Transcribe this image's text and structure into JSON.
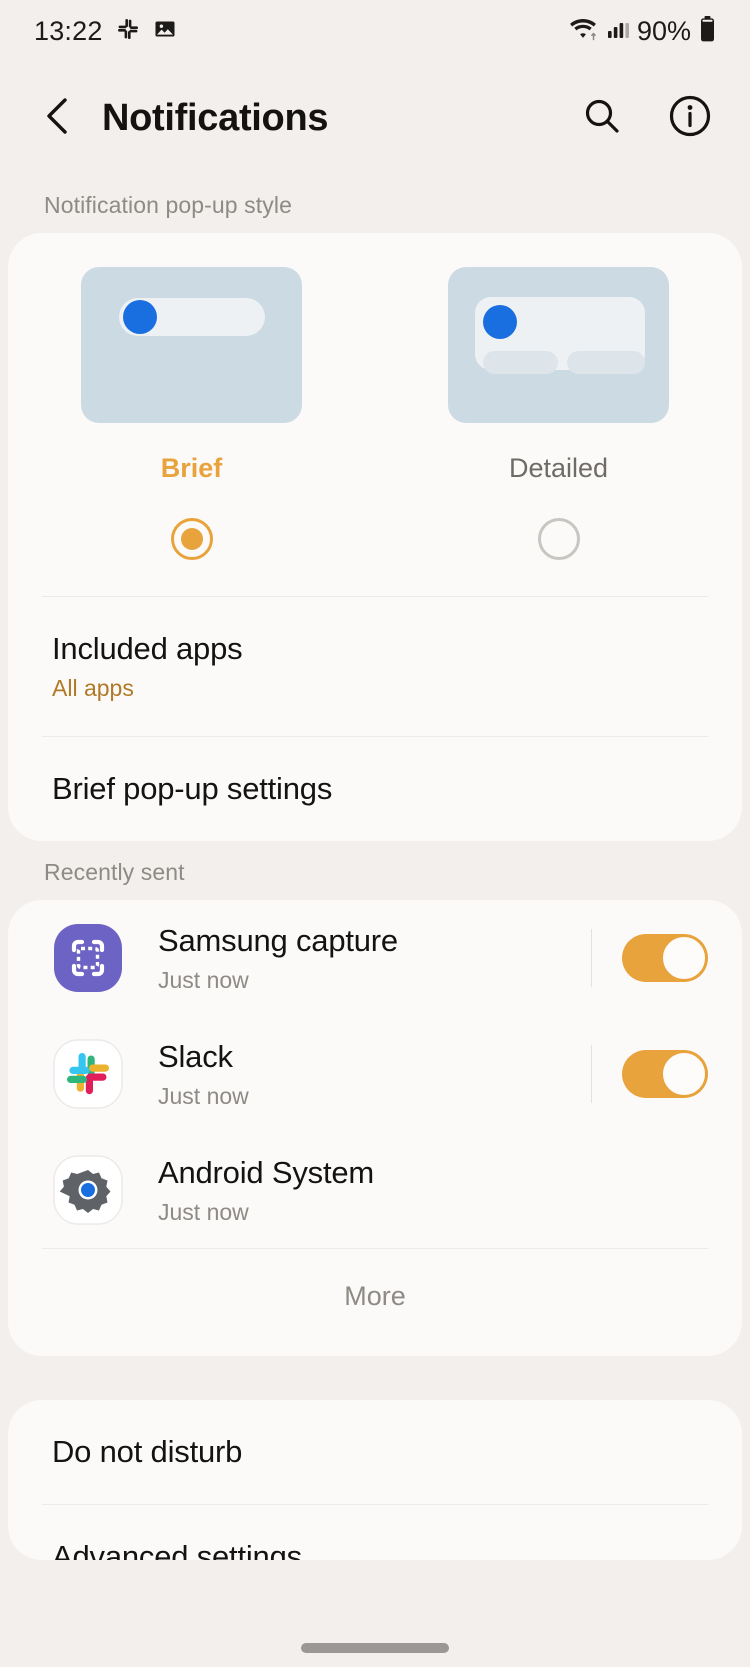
{
  "status_bar": {
    "time": "13:22",
    "battery_percent": "90%",
    "icons": [
      "slack-icon",
      "image-icon",
      "wifi-icon",
      "signal-icon",
      "battery-icon"
    ]
  },
  "header": {
    "title": "Notifications",
    "back_icon": "back-chevron-icon",
    "search_icon": "search-icon",
    "info_icon": "info-icon"
  },
  "popup_style": {
    "section_label": "Notification pop-up style",
    "options": [
      {
        "label": "Brief",
        "selected": true
      },
      {
        "label": "Detailed",
        "selected": false
      }
    ],
    "accent_color": "#e8a33c",
    "preview_bg": "#ccdae4",
    "preview_dot_color": "#1a6fe0"
  },
  "style_links": [
    {
      "title": "Included apps",
      "subtitle": "All apps"
    },
    {
      "title": "Brief pop-up settings",
      "subtitle": ""
    }
  ],
  "recently_sent": {
    "section_label": "Recently sent",
    "apps": [
      {
        "name": "Samsung capture",
        "time": "Just now",
        "icon": "samsung-capture-icon",
        "enabled": true
      },
      {
        "name": "Slack",
        "time": "Just now",
        "icon": "slack-icon",
        "enabled": true
      },
      {
        "name": "Android System",
        "time": "Just now",
        "icon": "android-system-gear-icon",
        "enabled": true
      }
    ],
    "more_label": "More"
  },
  "bottom_items": [
    {
      "title": "Do not disturb"
    },
    {
      "title": "Advanced settings"
    }
  ]
}
